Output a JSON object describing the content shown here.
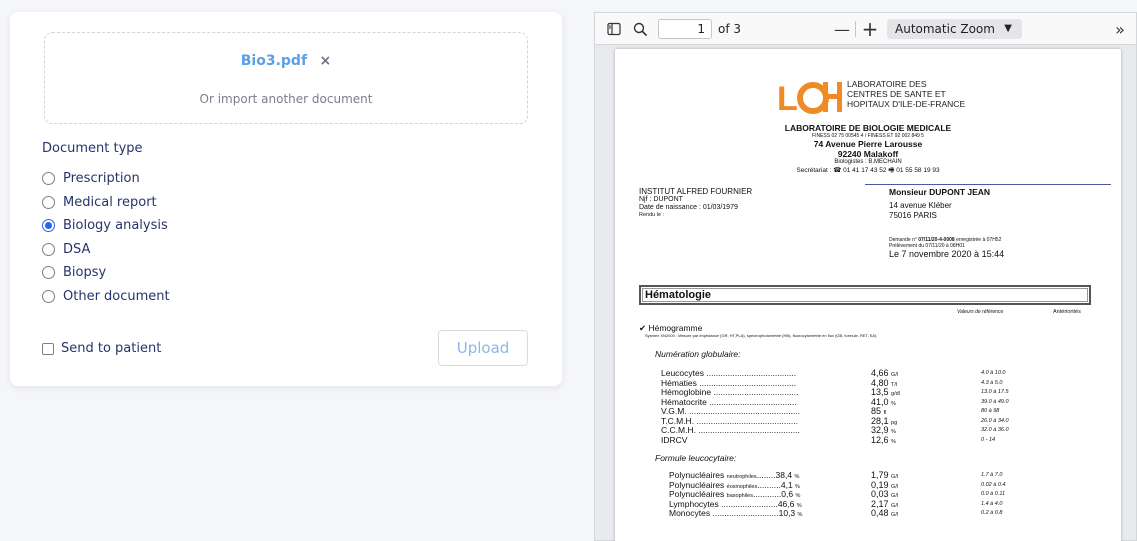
{
  "upload_card": {
    "file_name": "Bio3.pdf",
    "remove_icon": "×",
    "import_text": "Or import another document",
    "document_type_label": "Document type",
    "options": [
      {
        "label": "Prescription",
        "checked": false
      },
      {
        "label": "Medical report",
        "checked": false
      },
      {
        "label": "Biology analysis",
        "checked": true
      },
      {
        "label": "DSA",
        "checked": false
      },
      {
        "label": "Biopsy",
        "checked": false
      },
      {
        "label": "Other document",
        "checked": false
      }
    ],
    "send_to_patient_label": "Send to patient",
    "send_to_patient_checked": false,
    "upload_button": "Upload",
    "accent_color": "#2563eb"
  },
  "viewer": {
    "page_number": "1",
    "page_count": "of 3",
    "zoom_minus": "—",
    "zoom_plus": "+",
    "zoom_label": "Automatic Zoom",
    "more_icon": "»",
    "icons": [
      "sidebar-toggle-icon",
      "search-icon",
      "chevron-down-icon"
    ]
  },
  "document": {
    "logo_text": "LCH",
    "lab_name_lines": [
      "LABORATOIRE DES",
      "CENTRES DE SANTE ET",
      "HOPITAUX D'ILE-DE-FRANCE"
    ],
    "lab_title": "LABORATOIRE DE BIOLOGIE MEDICALE",
    "finess": "FINESS 02 75 00545 4 / FINESS ET 92 002 849 5",
    "address_street": "74 Avenue Pierre Larousse",
    "address_city": "92240 Malakoff",
    "biologists": "Biologistes : B.MECHAIN",
    "secretariat": "Secrétariat : ☎ 01 41 17 43 52   🖷 01 55 58 19 93",
    "institut": "INSTITUT ALFRED FOURNIER",
    "njf": "Njf :  DUPONT",
    "birth": "Date de naissance : 01/03/1979",
    "rendu": "Rendu le :",
    "patient_name": "Monsieur DUPONT JEAN",
    "patient_street": "14 avenue Kléber",
    "patient_city": "75016 PARIS",
    "demande_prefix": "Demande n°",
    "demande_number": "07/11/20-4-0008",
    "demande_suffix": "enregistrée à 07H52",
    "prelevement": "Prélèvement du 07/11/20 à 08H01",
    "date_line": "Le 7 novembre 2020 à 15:44",
    "section_title": "Hématologie",
    "col_ref": "Valeurs de référence",
    "col_ant": "Antériorités",
    "hemogramme": "Hémogramme",
    "hemogramme_note": "Sysmex XN2000 : Mesure par impédance (GR, HT,PLA), spectrophotométrie (HB), fluorocytométrie en flux (GB, formule, RET, EA)",
    "numeration_title": "Numération globulaire:",
    "numeration": [
      {
        "name": "Leucocytes ......................................",
        "value": "4,66",
        "unit": "G/l",
        "ref": "4.0 à 10.0"
      },
      {
        "name": "Hématies .........................................",
        "value": "4,80",
        "unit": "T/l",
        "ref": "4.3 à 5.0"
      },
      {
        "name": "Hémoglobine ....................................",
        "value": "13,5",
        "unit": "g/dl",
        "ref": "13.0 à 17.5"
      },
      {
        "name": "Hématocrite .....................................",
        "value": "41,0",
        "unit": "%",
        "ref": "39.0 à 49.0"
      },
      {
        "name": "V.G.M. ...............................................",
        "value": "85",
        "unit": "fl",
        "ref": "80 à 98"
      },
      {
        "name": "T.C.M.H. ...........................................",
        "value": "28,1",
        "unit": "pg",
        "ref": "26.0 à 34.0"
      },
      {
        "name": "C.C.M.H. ...........................................",
        "value": "32,9",
        "unit": "%",
        "ref": "32.0 à 36.0"
      },
      {
        "name": "IDRCV",
        "value": "12,6",
        "unit": "%",
        "ref": "0 - 14"
      }
    ],
    "formule_title": "Formule leucocytaire:",
    "formule": [
      {
        "name": "Polynucléaires",
        "sub": "neutrophiles",
        "dots": "........38,4",
        "unit": "%",
        "value": "1,79",
        "vunit": "G/l",
        "ref": "1.7 à 7.0"
      },
      {
        "name": "Polynucléaires",
        "sub": "éosinophiles",
        "dots": "..........4,1",
        "unit": "%",
        "value": "0,19",
        "vunit": "G/l",
        "ref": "0.02 à 0.4"
      },
      {
        "name": "Polynucléaires",
        "sub": "basophiles",
        "dots": "............0,6",
        "unit": "%",
        "value": "0,03",
        "vunit": "G/l",
        "ref": "0.0 à 0.11"
      },
      {
        "name": "Lymphocytes",
        "sub": "",
        "dots": "........................46,6",
        "unit": "%",
        "value": "2,17",
        "vunit": "G/l",
        "ref": "1.4 à 4.0"
      },
      {
        "name": "Monocytes",
        "sub": "",
        "dots": "............................10,3",
        "unit": "%",
        "value": "0,48",
        "vunit": "G/l",
        "ref": "0.2 à 0.8"
      }
    ]
  }
}
